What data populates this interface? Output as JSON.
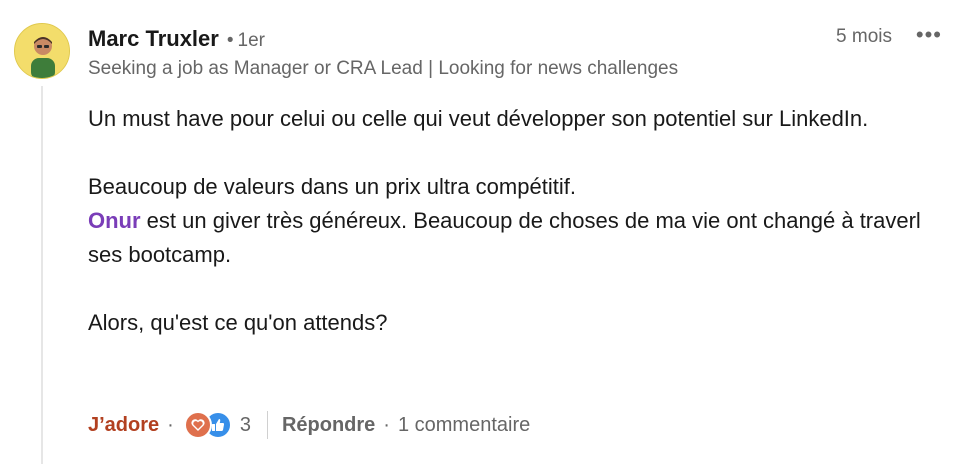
{
  "comment": {
    "author": {
      "name": "Marc Truxler",
      "degree_sep": "•",
      "degree": "1er",
      "headline": "Seeking a job as Manager or CRA Lead | Looking for news challenges"
    },
    "time": "5 mois",
    "more_label": "•••",
    "body": {
      "line1": "Un must have pour celui ou celle qui veut développer son potentiel sur LinkedIn.",
      "line2": "Beaucoup de valeurs dans un prix ultra compétitif.",
      "mention": "Onur",
      "line3_rest": " est un giver très généreux. Beaucoup de choses de ma vie ont changé à traverl ses bootcamp.",
      "line4": "Alors, qu'est ce qu'on attends?"
    }
  },
  "actions": {
    "like_label": "J’adore",
    "dot": "·",
    "reaction_count": "3",
    "reply_label": "Répondre",
    "replies_count": "1 commentaire"
  },
  "colors": {
    "like_active": "#b24020",
    "mention": "#7a3db8",
    "secondary_text": "#666666",
    "love_reaction": "#df704d",
    "like_reaction": "#378fe9"
  },
  "icons": {
    "avatar": "avatar",
    "more": "more-dots-icon",
    "love_reaction": "heart-icon",
    "like_reaction": "thumbs-up-icon"
  }
}
